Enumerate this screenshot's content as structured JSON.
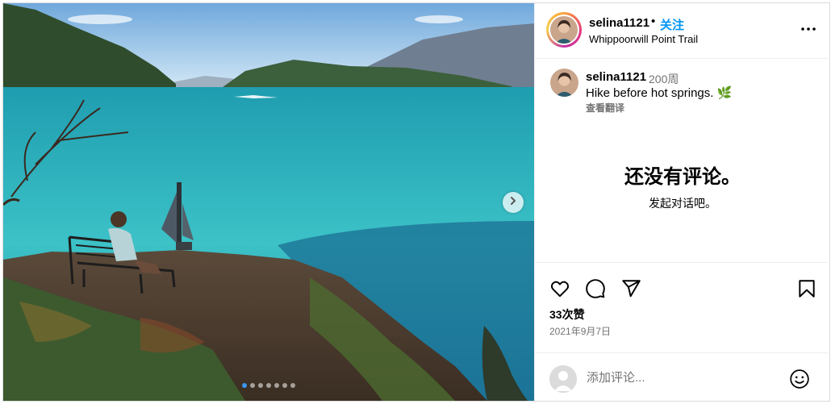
{
  "post": {
    "username": "selina1121",
    "follow_separator": "•",
    "follow_label": "关注",
    "location": "Whippoorwill Point Trail"
  },
  "caption": {
    "username": "selina1121",
    "time_ago": "200周",
    "text": "Hike before hot springs. 🌿",
    "translate_label": "查看翻译"
  },
  "comments": {
    "empty_title": "还没有评论。",
    "empty_subtitle": "发起对话吧。"
  },
  "stats": {
    "likes": "33次赞",
    "date": "2021年9月7日"
  },
  "composer": {
    "placeholder": "添加评论..."
  },
  "carousel": {
    "slide_count": 7,
    "active_index": 0
  },
  "icons": {
    "more": "more-horizontal-icon",
    "like": "heart-icon",
    "comment": "comment-icon",
    "share": "send-icon",
    "save": "bookmark-icon",
    "next": "chevron-right-icon",
    "emoji": "emoji-icon"
  },
  "colors": {
    "follow": "#0095f6",
    "muted": "#737373",
    "border": "#efefef"
  }
}
